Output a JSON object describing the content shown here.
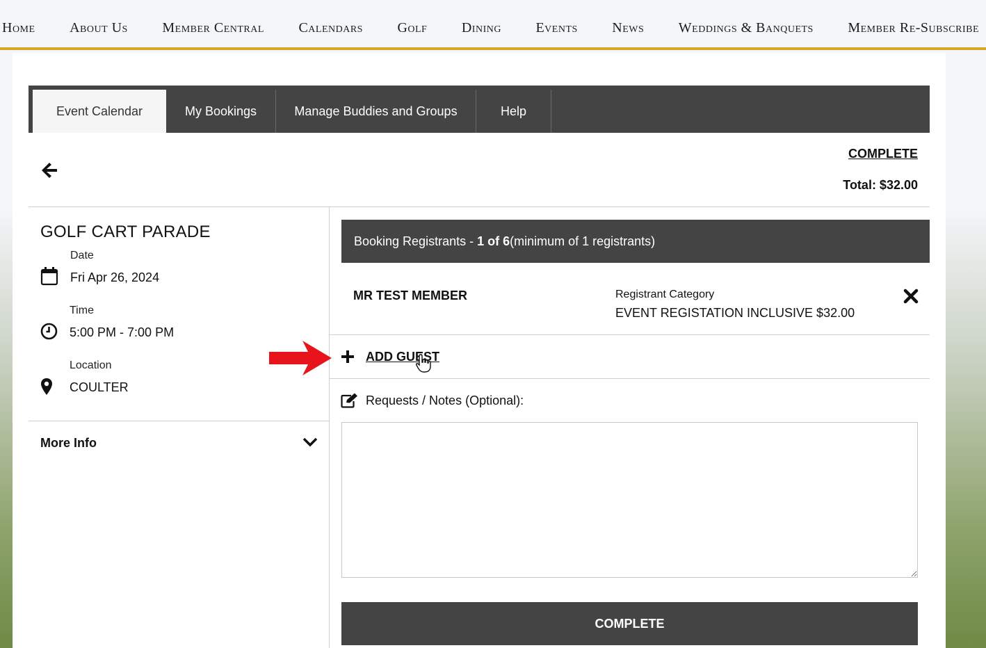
{
  "nav": {
    "items": [
      "Home",
      "About Us",
      "Member Central",
      "Calendars",
      "Golf",
      "Dining",
      "Events",
      "News",
      "Weddings & Banquets",
      "Member Re-Subscribe"
    ]
  },
  "tabs": [
    {
      "label": "Event Calendar",
      "active": true
    },
    {
      "label": "My Bookings",
      "active": false
    },
    {
      "label": "Manage Buddies and Groups",
      "active": false
    },
    {
      "label": "Help",
      "active": false
    }
  ],
  "header": {
    "complete_link": "COMPLETE",
    "total": "Total: $32.00"
  },
  "event": {
    "title": "GOLF CART PARADE",
    "date_label": "Date",
    "date": "Fri Apr 26, 2024",
    "time_label": "Time",
    "time": "5:00 PM - 7:00 PM",
    "location_label": "Location",
    "location": "COULTER",
    "more_info": "More Info"
  },
  "registrants": {
    "header_prefix": "Booking Registrants - ",
    "count": "1 of 6",
    "header_suffix": " (minimum of 1 registrants)",
    "rows": [
      {
        "name": "MR TEST MEMBER",
        "category_label": "Registrant Category",
        "category": "EVENT REGISTATION INCLUSIVE $32.00"
      }
    ],
    "add_guest": "ADD GUEST"
  },
  "notes": {
    "label": "Requests / Notes (Optional):",
    "value": ""
  },
  "footer": {
    "complete_button": "COMPLETE"
  },
  "colors": {
    "accent_gold": "#d4a62a",
    "dark_bar": "#444444",
    "annotation_red": "#e8141c"
  }
}
